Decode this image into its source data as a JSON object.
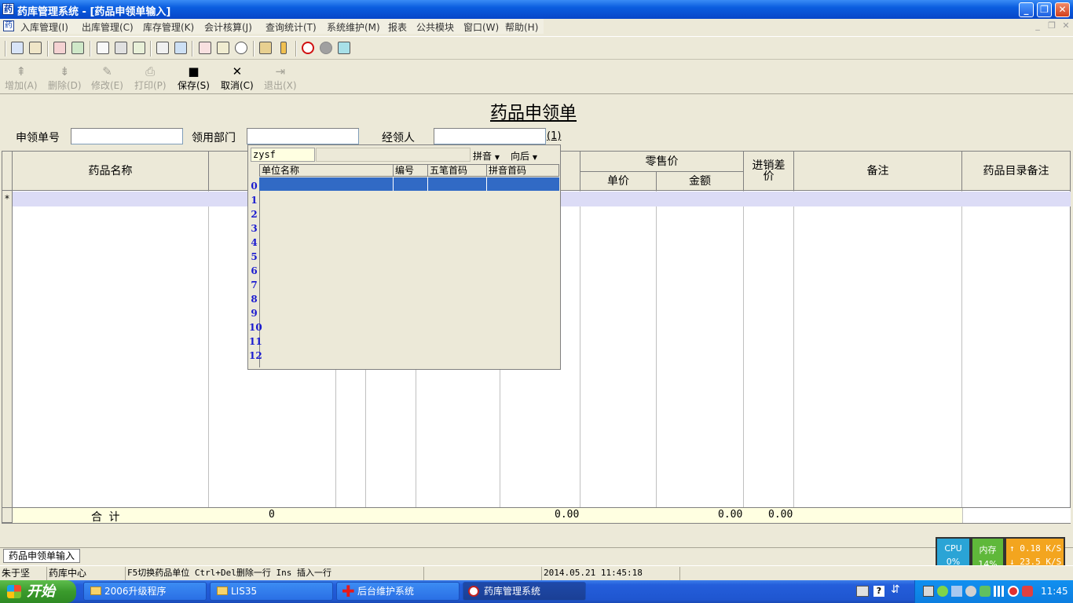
{
  "window": {
    "title": "药库管理系统 - [药品申领单输入]",
    "app_icon": "app-icon",
    "minimize": "0",
    "restore": "2",
    "close": "r"
  },
  "menu": [
    "入库管理(I)",
    "出库管理(C)",
    "库存管理(K)",
    "会计核算(J)",
    "查询统计(T)",
    "系统维护(M)",
    "报表",
    "公共模块",
    "窗口(W)",
    "帮助(H)"
  ],
  "toolbar2": {
    "add": "增加(A)",
    "delete": "删除(D)",
    "edit": "修改(E)",
    "print": "打印(P)",
    "save": "保存(S)",
    "cancel": "取消(C)",
    "exit": "退出(X)"
  },
  "form": {
    "title": "药品申领单",
    "order_no_label": "申领单号",
    "order_no_value": "",
    "dept_label": "领用部门",
    "dept_value": "",
    "handler_label": "经领人",
    "handler_value": "",
    "page_indicator": "(1)"
  },
  "grid": {
    "headers": {
      "drug_name": "药品名称",
      "retail": "零售价",
      "unit_price": "单价",
      "amount": "金额",
      "spread": "进销差价",
      "remark": "备注",
      "catalog_remark": "药品目录备注"
    },
    "new_row_marker": "*",
    "total": {
      "label": "合 计",
      "qty": "0",
      "cost_amount": "0.00",
      "retail_amount": "0.00",
      "spread": "0.00"
    }
  },
  "popup": {
    "search_value": "zysf",
    "mode": "拼音",
    "direction": "向后",
    "columns": [
      "单位名称",
      "编号",
      "五笔首码",
      "拼音首码"
    ],
    "row_numbers": [
      "0",
      "1",
      "2",
      "3",
      "4",
      "5",
      "6",
      "7",
      "8",
      "9",
      "10",
      "11",
      "12"
    ]
  },
  "mdi_tab": "药品申领单输入",
  "status": {
    "user": "朱于坚",
    "dept": "药库中心",
    "hint": "F5切换药品单位 Ctrl+Del删除一行 Ins 插入一行",
    "datetime": "2014.05.21 11:45:18"
  },
  "monitor": {
    "cpu_label": "CPU",
    "cpu_value": "0%",
    "mem_label": "内存",
    "mem_value": "14%",
    "up": "0.18 K/S",
    "down": "23.5 K/S"
  },
  "taskbar": {
    "start": "开始",
    "tasks": [
      "2006升级程序",
      "LIS35",
      "后台维护系统",
      "药库管理系统"
    ],
    "clock": "11:45"
  }
}
